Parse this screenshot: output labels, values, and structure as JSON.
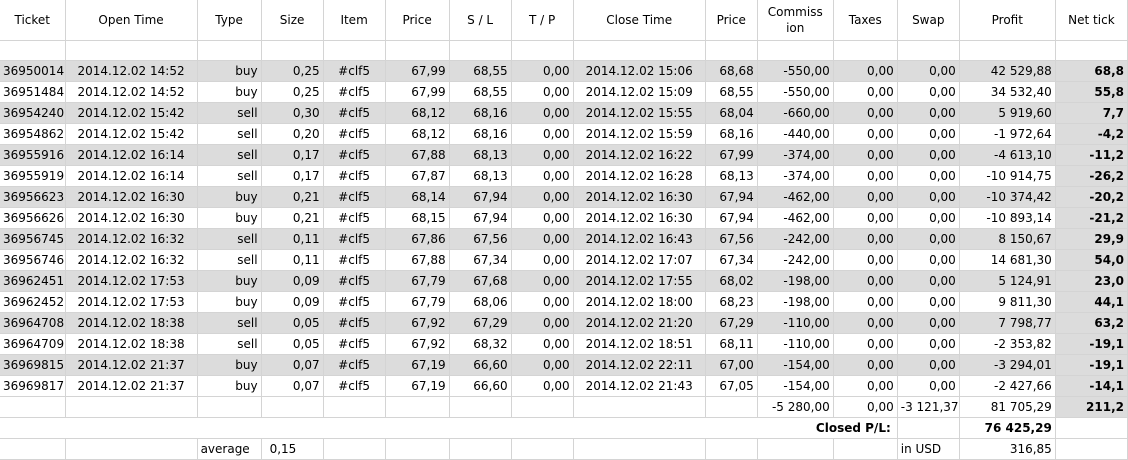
{
  "headers": [
    "Ticket",
    "Open Time",
    "Type",
    "Size",
    "Item",
    "Price",
    "S / L",
    "T / P",
    "Close Time",
    "Price",
    "Commiss\nion",
    "Taxes",
    "Swap",
    "Profit",
    "Net tick"
  ],
  "rows": [
    [
      "36950014",
      "2014.12.02 14:52",
      "buy",
      "0,25",
      "#clf5",
      "67,99",
      "68,55",
      "0,00",
      "2014.12.02 15:06",
      "68,68",
      "-550,00",
      "0,00",
      "0,00",
      "42 529,88",
      "68,8"
    ],
    [
      "36951484",
      "2014.12.02 14:52",
      "buy",
      "0,25",
      "#clf5",
      "67,99",
      "68,55",
      "0,00",
      "2014.12.02 15:09",
      "68,55",
      "-550,00",
      "0,00",
      "0,00",
      "34 532,40",
      "55,8"
    ],
    [
      "36954240",
      "2014.12.02 15:42",
      "sell",
      "0,30",
      "#clf5",
      "68,12",
      "68,16",
      "0,00",
      "2014.12.02 15:55",
      "68,04",
      "-660,00",
      "0,00",
      "0,00",
      "5 919,60",
      "7,7"
    ],
    [
      "36954862",
      "2014.12.02 15:42",
      "sell",
      "0,20",
      "#clf5",
      "68,12",
      "68,16",
      "0,00",
      "2014.12.02 15:59",
      "68,16",
      "-440,00",
      "0,00",
      "0,00",
      "-1 972,64",
      "-4,2"
    ],
    [
      "36955916",
      "2014.12.02 16:14",
      "sell",
      "0,17",
      "#clf5",
      "67,88",
      "68,13",
      "0,00",
      "2014.12.02 16:22",
      "67,99",
      "-374,00",
      "0,00",
      "0,00",
      "-4 613,10",
      "-11,2"
    ],
    [
      "36955919",
      "2014.12.02 16:14",
      "sell",
      "0,17",
      "#clf5",
      "67,87",
      "68,13",
      "0,00",
      "2014.12.02 16:28",
      "68,13",
      "-374,00",
      "0,00",
      "0,00",
      "-10 914,75",
      "-26,2"
    ],
    [
      "36956623",
      "2014.12.02 16:30",
      "buy",
      "0,21",
      "#clf5",
      "68,14",
      "67,94",
      "0,00",
      "2014.12.02 16:30",
      "67,94",
      "-462,00",
      "0,00",
      "0,00",
      "-10 374,42",
      "-20,2"
    ],
    [
      "36956626",
      "2014.12.02 16:30",
      "buy",
      "0,21",
      "#clf5",
      "68,15",
      "67,94",
      "0,00",
      "2014.12.02 16:30",
      "67,94",
      "-462,00",
      "0,00",
      "0,00",
      "-10 893,14",
      "-21,2"
    ],
    [
      "36956745",
      "2014.12.02 16:32",
      "sell",
      "0,11",
      "#clf5",
      "67,86",
      "67,56",
      "0,00",
      "2014.12.02 16:43",
      "67,56",
      "-242,00",
      "0,00",
      "0,00",
      "8 150,67",
      "29,9"
    ],
    [
      "36956746",
      "2014.12.02 16:32",
      "sell",
      "0,11",
      "#clf5",
      "67,88",
      "67,34",
      "0,00",
      "2014.12.02 17:07",
      "67,34",
      "-242,00",
      "0,00",
      "0,00",
      "14 681,30",
      "54,0"
    ],
    [
      "36962451",
      "2014.12.02 17:53",
      "buy",
      "0,09",
      "#clf5",
      "67,79",
      "67,68",
      "0,00",
      "2014.12.02 17:55",
      "68,02",
      "-198,00",
      "0,00",
      "0,00",
      "5 124,91",
      "23,0"
    ],
    [
      "36962452",
      "2014.12.02 17:53",
      "buy",
      "0,09",
      "#clf5",
      "67,79",
      "68,06",
      "0,00",
      "2014.12.02 18:00",
      "68,23",
      "-198,00",
      "0,00",
      "0,00",
      "9 811,30",
      "44,1"
    ],
    [
      "36964708",
      "2014.12.02 18:38",
      "sell",
      "0,05",
      "#clf5",
      "67,92",
      "67,29",
      "0,00",
      "2014.12.02 21:20",
      "67,29",
      "-110,00",
      "0,00",
      "0,00",
      "7 798,77",
      "63,2"
    ],
    [
      "36964709",
      "2014.12.02 18:38",
      "sell",
      "0,05",
      "#clf5",
      "67,92",
      "68,32",
      "0,00",
      "2014.12.02 18:51",
      "68,11",
      "-110,00",
      "0,00",
      "0,00",
      "-2 353,82",
      "-19,1"
    ],
    [
      "36969815",
      "2014.12.02 21:37",
      "buy",
      "0,07",
      "#clf5",
      "67,19",
      "66,60",
      "0,00",
      "2014.12.02 22:11",
      "67,00",
      "-154,00",
      "0,00",
      "0,00",
      "-3 294,01",
      "-19,1"
    ],
    [
      "36969817",
      "2014.12.02 21:37",
      "buy",
      "0,07",
      "#clf5",
      "67,19",
      "66,60",
      "0,00",
      "2014.12.02 21:43",
      "67,05",
      "-154,00",
      "0,00",
      "0,00",
      "-2 427,66",
      "-14,1"
    ]
  ],
  "totals": {
    "commission": "-5 280,00",
    "taxes": "0,00",
    "swap": "-3 121,37",
    "profit": "81 705,29",
    "net_tick": "211,2"
  },
  "closed": {
    "label": "Closed P/L:",
    "value": "76 425,29"
  },
  "footer": {
    "average_label": "average",
    "average_value": "0,15",
    "currency_label": "in USD",
    "currency_value": "316,85"
  }
}
